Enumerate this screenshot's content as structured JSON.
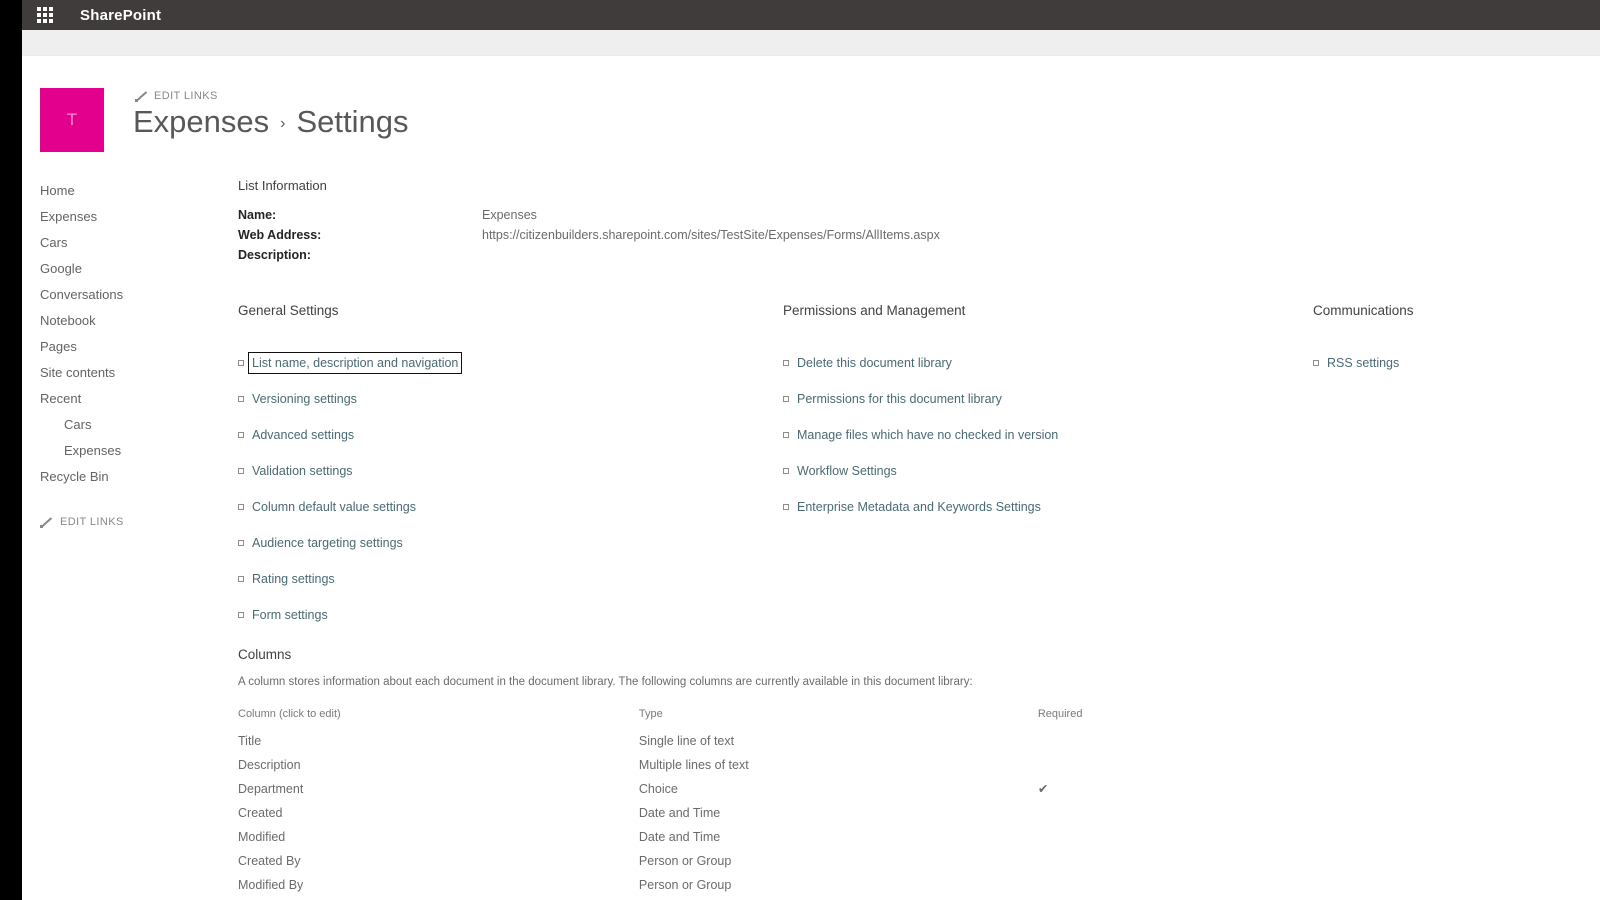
{
  "suite": {
    "waffle_label": "app-launcher",
    "brand": "SharePoint"
  },
  "site": {
    "logo_letter": "T",
    "edit_links_label": "EDIT LINKS",
    "breadcrumb": {
      "parent": "Expenses",
      "separator": "›",
      "current": "Settings"
    }
  },
  "sidebar": {
    "items": [
      {
        "label": "Home",
        "indent": false
      },
      {
        "label": "Expenses",
        "indent": false
      },
      {
        "label": "Cars",
        "indent": false
      },
      {
        "label": "Google",
        "indent": false
      },
      {
        "label": "Conversations",
        "indent": false
      },
      {
        "label": "Notebook",
        "indent": false
      },
      {
        "label": "Pages",
        "indent": false
      },
      {
        "label": "Site contents",
        "indent": false
      },
      {
        "label": "Recent",
        "indent": false
      },
      {
        "label": "Cars",
        "indent": true
      },
      {
        "label": "Expenses",
        "indent": true
      },
      {
        "label": "Recycle Bin",
        "indent": false
      }
    ],
    "edit_links_label": "EDIT LINKS"
  },
  "list_information": {
    "heading": "List Information",
    "rows": [
      {
        "label": "Name:",
        "value": "Expenses"
      },
      {
        "label": "Web Address:",
        "value": "https://citizenbuilders.sharepoint.com/sites/TestSite/Expenses/Forms/AllItems.aspx"
      },
      {
        "label": "Description:",
        "value": ""
      }
    ]
  },
  "general_settings": {
    "heading": "General Settings",
    "links": [
      {
        "label": "List name, description and navigation",
        "focused": true
      },
      {
        "label": "Versioning settings",
        "focused": false
      },
      {
        "label": "Advanced settings",
        "focused": false
      },
      {
        "label": "Validation settings",
        "focused": false
      },
      {
        "label": "Column default value settings",
        "focused": false
      },
      {
        "label": "Audience targeting settings",
        "focused": false
      },
      {
        "label": "Rating settings",
        "focused": false
      },
      {
        "label": "Form settings",
        "focused": false
      }
    ]
  },
  "permissions_management": {
    "heading": "Permissions and Management",
    "links": [
      {
        "label": "Delete this document library",
        "focused": false
      },
      {
        "label": "Permissions for this document library",
        "focused": false
      },
      {
        "label": "Manage files which have no checked in version",
        "focused": false
      },
      {
        "label": "Workflow Settings",
        "focused": false
      },
      {
        "label": "Enterprise Metadata and Keywords Settings",
        "focused": false
      }
    ]
  },
  "communications": {
    "heading": "Communications",
    "links": [
      {
        "label": "RSS settings",
        "focused": false
      }
    ]
  },
  "columns_section": {
    "title": "Columns",
    "description": "A column stores information about each document in the document library. The following columns are currently available in this document library:",
    "headers": [
      "Column (click to edit)",
      "Type",
      "Required"
    ],
    "rows": [
      {
        "name": "Title",
        "type": "Single line of text",
        "required": ""
      },
      {
        "name": "Description",
        "type": "Multiple lines of text",
        "required": ""
      },
      {
        "name": "Department",
        "type": "Choice",
        "required": "✔"
      },
      {
        "name": "Created",
        "type": "Date and Time",
        "required": ""
      },
      {
        "name": "Modified",
        "type": "Date and Time",
        "required": ""
      },
      {
        "name": "Created By",
        "type": "Person or Group",
        "required": ""
      },
      {
        "name": "Modified By",
        "type": "Person or Group",
        "required": ""
      }
    ]
  },
  "colors": {
    "suite_bar": "#403c3b",
    "site_logo": "#e3008c",
    "link": "#4b6a72",
    "text": "#6b6b6b"
  }
}
